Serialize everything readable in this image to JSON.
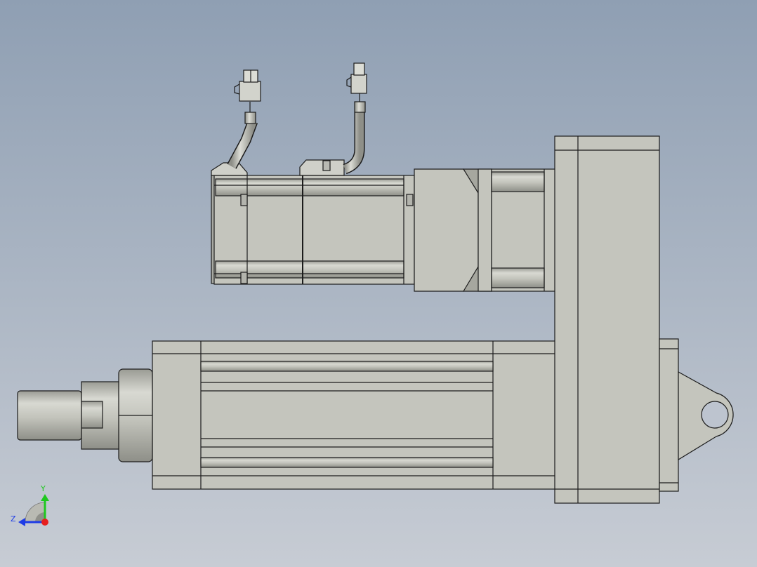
{
  "viewport": {
    "background_top": "#8f9fb3",
    "background_bottom": "#c7ccd4"
  },
  "model": {
    "fill": "#c4c5bd",
    "fill_dark": "#9e9f98",
    "fill_light": "#dedfd8",
    "edge": "#1c1c1c"
  },
  "triad": {
    "y_label": "Y",
    "z_label": "Z",
    "y_color": "#1ec81e",
    "z_color": "#1e3ce6",
    "x_color": "#e61e1e"
  }
}
